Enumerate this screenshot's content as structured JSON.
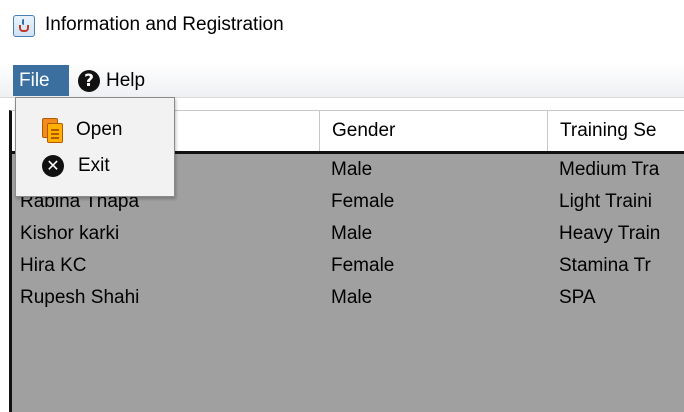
{
  "window": {
    "title": "Information and Registration",
    "icon": "java-cup-icon"
  },
  "menubar": {
    "file_label": "File",
    "help_label": "Help",
    "help_icon": "question-circle-icon"
  },
  "file_menu": {
    "items": [
      {
        "label": "Open",
        "icon": "open-documents-icon"
      },
      {
        "label": "Exit",
        "icon": "close-circle-icon"
      }
    ]
  },
  "table": {
    "columns": [
      "",
      "Gender",
      "Training Se"
    ],
    "rows": [
      [
        "",
        "Male",
        "Medium Tra"
      ],
      [
        "Rabina Thapa",
        "Female",
        "Light Traini"
      ],
      [
        "Kishor karki",
        "Male",
        "Heavy Train"
      ],
      [
        "Hira KC",
        "Female",
        "Stamina Tr"
      ],
      [
        "Rupesh Shahi",
        "Male",
        "SPA"
      ]
    ]
  },
  "colors": {
    "menu_selected": "#3b6fa0",
    "table_body": "#a0a0a0"
  }
}
